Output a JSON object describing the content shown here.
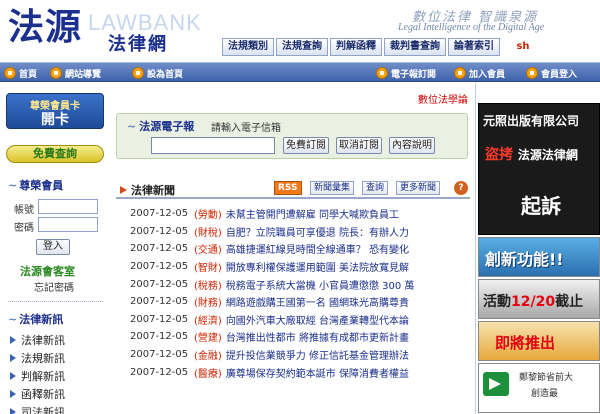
{
  "header": {
    "logo_main": "法源",
    "logo_lawbank": "LAWBANK",
    "logo_sub": "法律網",
    "slogan": "數位法律 智識泉源",
    "slogan_en": "Legal Intelligence of the Digital Age",
    "nav": [
      "法規類別",
      "法規查詢",
      "判解函釋",
      "裁判書查詢",
      "論著索引"
    ],
    "user_badge": "sh"
  },
  "toolbar": {
    "left": [
      "首頁",
      "網站導覽",
      "設為首頁"
    ],
    "right": [
      "電子報訂閱",
      "加入會員",
      "會員登入"
    ]
  },
  "sidebar": {
    "vip_card_line1": "尊榮會員卡",
    "vip_card_line2": "開卡",
    "free_query": "免費查詢",
    "member_heading": "尊榮會員",
    "account_label": "帳號",
    "password_label": "密碼",
    "login_button": "登入",
    "member_home": "法源會客室",
    "forgot_password": "忘記密碼",
    "law_news_heading": "法律新訊",
    "law_news_items": [
      "法律新訊",
      "法規新訊",
      "判解新訊",
      "函釋新訊",
      "司法新訊"
    ]
  },
  "center": {
    "digital_law_link": "數位法學論",
    "epaper": {
      "title": "法源電子報",
      "hint": "請輸入電子信箱",
      "subscribe_button": "免費訂閱",
      "unsubscribe_button": "取消訂閱",
      "content_button": "內容說明"
    },
    "news": {
      "title": "法律新聞",
      "rss": "RSS",
      "archive": "新聞彙集",
      "search": "查詢",
      "more": "更多新聞",
      "help": "?",
      "items": [
        {
          "date": "2007-12-05",
          "tag": "(勞動)",
          "text": "未幫主管開門遭解雇 同學大喊欺負員工"
        },
        {
          "date": "2007-12-05",
          "tag": "(財稅)",
          "text": "自肥？立院職員可享優退 院長：有辦人力"
        },
        {
          "date": "2007-12-05",
          "tag": "(交通)",
          "text": "高雄捷運紅線見時間全線通車？ 恐有變化"
        },
        {
          "date": "2007-12-05",
          "tag": "(智財)",
          "text": "開放專利權保護運用範圍 美法院放寬見解"
        },
        {
          "date": "2007-12-05",
          "tag": "(稅務)",
          "text": "稅務電子系統大當機 小官員遭懲懲 300 萬"
        },
        {
          "date": "2007-12-05",
          "tag": "(財務)",
          "text": "網路遊戲購王國第一名 國網珠光高購尊貴"
        },
        {
          "date": "2007-12-05",
          "tag": "(經濟)",
          "text": "向國外汽車大廠取經 台灣產業轉型代本論"
        },
        {
          "date": "2007-12-05",
          "tag": "(營建)",
          "text": "台灣推出性都市 將推據有成都市更新計畫"
        },
        {
          "date": "2007-12-05",
          "tag": "(金融)",
          "text": "提升投信業競爭力 修正信託基金管理辦法"
        },
        {
          "date": "2007-12-05",
          "tag": "(醫療)",
          "text": "廣尊場保存契約範本誕市 保障消費者權益"
        }
      ]
    }
  },
  "right": {
    "ad_top_line1": "元照出版有限公司",
    "ad_top_line2a": "盜拷",
    "ad_top_line2b": "法源法律網",
    "ad_top_line3": "起訴",
    "ad_b1": "創新功能!!",
    "ad_b2a": "活動",
    "ad_b2b": "12/20",
    "ad_b2c": "截止",
    "ad_b3": "即將推出",
    "ad_b4_line1": "鄭黎節省前大",
    "ad_b4_line2": "創造最"
  }
}
